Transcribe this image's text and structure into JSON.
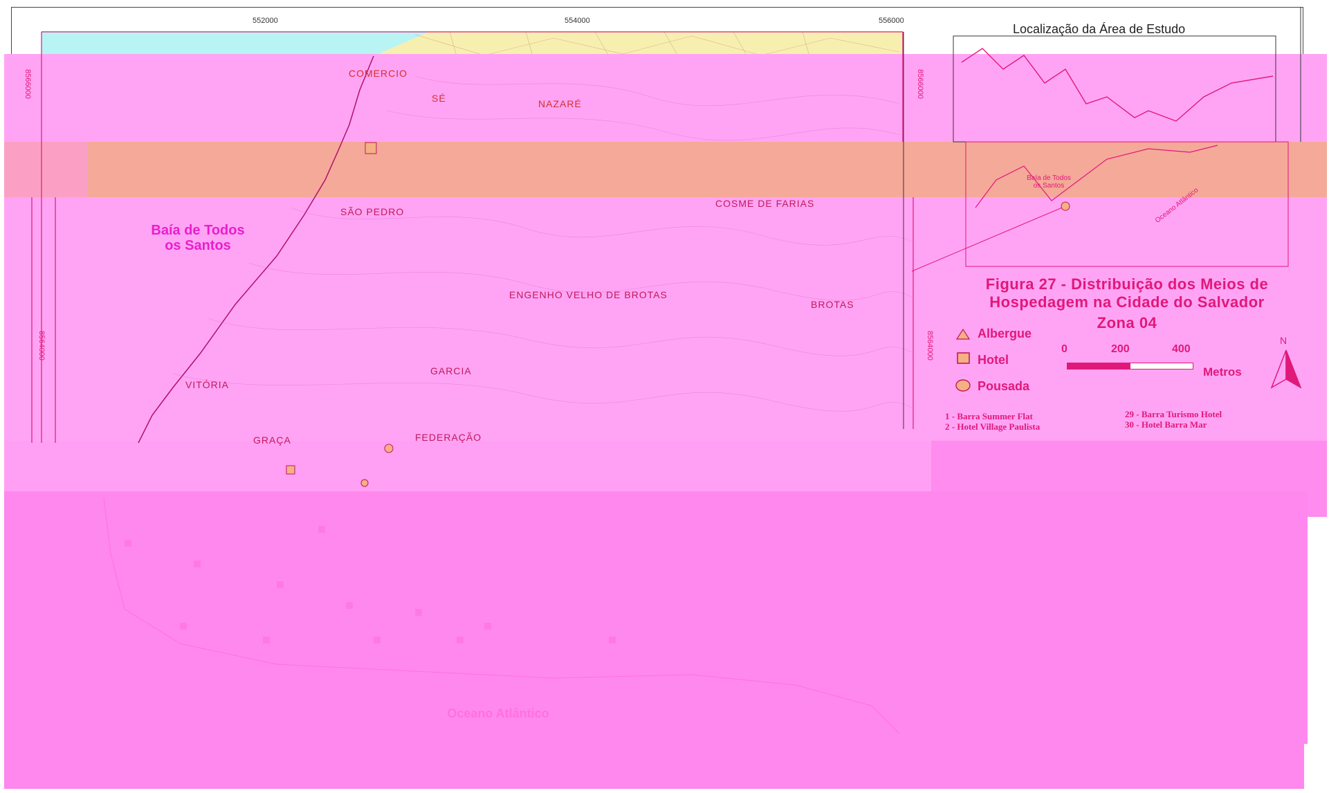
{
  "map": {
    "x_ticks": [
      "552000",
      "554000",
      "556000"
    ],
    "y_ticks_left": [
      "8566000",
      "8564000"
    ],
    "y_ticks_right": [
      "8566000",
      "8564000"
    ],
    "neighborhoods": [
      {
        "name": "COMERCIO",
        "key": "comercio",
        "style": "top"
      },
      {
        "name": "SÉ",
        "key": "se",
        "style": "top"
      },
      {
        "name": "NAZARÉ",
        "key": "nazare",
        "style": "top"
      },
      {
        "name": "SÃO PEDRO",
        "key": "sao-pedro",
        "style": "mid"
      },
      {
        "name": "COSME DE FARIAS",
        "key": "cosme-de-farias",
        "style": "mid"
      },
      {
        "name": "ENGENHO VELHO DE BROTAS",
        "key": "engenho-velho-de-brotas",
        "style": "mid"
      },
      {
        "name": "BROTAS",
        "key": "brotas",
        "style": "mid"
      },
      {
        "name": "GARCIA",
        "key": "garcia",
        "style": "mid"
      },
      {
        "name": "VITÓRIA",
        "key": "vitoria",
        "style": "mid"
      },
      {
        "name": "FEDERAÇÃO",
        "key": "federacao",
        "style": "mid"
      },
      {
        "name": "GRAÇA",
        "key": "graca",
        "style": "mid"
      }
    ],
    "bay_label": "Baía de Todos\nos Santos",
    "ocean_label": "Oceano Atlântico"
  },
  "inset": {
    "title": "Localização da Área de Estudo",
    "bay_label": "Baía de Todos\nos Santos",
    "ocean_label": "Oceano Atlântico"
  },
  "legend": {
    "title_line1": "Figura 27 - Distribuição dos Meios de",
    "title_line2": "Hospedagem na Cidade do Salvador",
    "title_line3": "Zona 04",
    "items": [
      {
        "label": "Albergue",
        "icon": "triangle-icon"
      },
      {
        "label": "Hotel",
        "icon": "square-icon"
      },
      {
        "label": "Pousada",
        "icon": "circle-icon"
      }
    ],
    "scale": {
      "ticks": [
        "0",
        "200",
        "400"
      ],
      "unit": "Metros"
    },
    "north": "N",
    "list_left": [
      "1 - Barra Summer Flat",
      "2 - Hotel Village Paulista"
    ],
    "list_right": [
      "29 - Barra Turismo Hotel",
      "30 - Hotel Barra Mar"
    ]
  },
  "colors": {
    "overlay": "#ff88ee",
    "band_orange": "#f5a999",
    "sea": "#b8f4f4",
    "land": "#f7efb0",
    "accent": "#e0187a"
  }
}
